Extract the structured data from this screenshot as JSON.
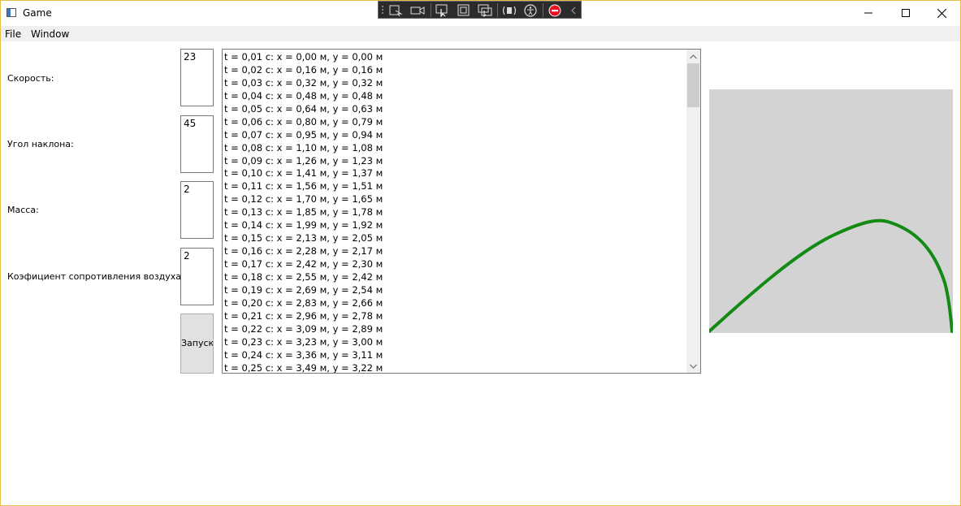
{
  "window": {
    "title": "Game"
  },
  "menu": {
    "items": [
      "File",
      "Window"
    ]
  },
  "form": {
    "labels": [
      "Скорость:",
      "Угол наклона:",
      "Масса:",
      "Коэфициент сопротивления воздуха:"
    ],
    "values": [
      "23",
      "45",
      "2",
      "2"
    ],
    "run_label": "Запуск"
  },
  "log": {
    "lines": [
      "t = 0,01 с: x = 0,00 м, y = 0,00 м",
      "t = 0,02 с: x = 0,16 м, y = 0,16 м",
      "t = 0,03 с: x = 0,32 м, y = 0,32 м",
      "t = 0,04 с: x = 0,48 м, y = 0,48 м",
      "t = 0,05 с: x = 0,64 м, y = 0,63 м",
      "t = 0,06 с: x = 0,80 м, y = 0,79 м",
      "t = 0,07 с: x = 0,95 м, y = 0,94 м",
      "t = 0,08 с: x = 1,10 м, y = 1,08 м",
      "t = 0,09 с: x = 1,26 м, y = 1,23 м",
      "t = 0,10 с: x = 1,41 м, y = 1,37 м",
      "t = 0,11 с: x = 1,56 м, y = 1,51 м",
      "t = 0,12 с: x = 1,70 м, y = 1,65 м",
      "t = 0,13 с: x = 1,85 м, y = 1,78 м",
      "t = 0,14 с: x = 1,99 м, y = 1,92 м",
      "t = 0,15 с: x = 2,13 м, y = 2,05 м",
      "t = 0,16 с: x = 2,28 м, y = 2,17 м",
      "t = 0,17 с: x = 2,42 м, y = 2,30 м",
      "t = 0,18 с: x = 2,55 м, y = 2,42 м",
      "t = 0,19 с: x = 2,69 м, y = 2,54 м",
      "t = 0,20 с: x = 2,83 м, y = 2,66 м",
      "t = 0,21 с: x = 2,96 м, y = 2,78 м",
      "t = 0,22 с: x = 3,09 м, y = 2,89 м",
      "t = 0,23 с: x = 3,23 м, y = 3,00 м",
      "t = 0,24 с: x = 3,36 м, y = 3,11 м",
      "t = 0,25 с: x = 3,49 м, y = 3,22 м"
    ]
  },
  "trajectory": {
    "color": "#138a13",
    "background": "#d3d3d3"
  },
  "debug_toolbar": {
    "icons": [
      "gripper-icon",
      "select-element-icon",
      "camera-icon",
      "pointer-select-icon",
      "layout-adorner-icon",
      "track-focus-icon",
      "binding-failures-icon",
      "accessibility-icon",
      "stop-icon",
      "collapse-chevron-icon"
    ]
  },
  "colors": {
    "window_border": "#e3c04a",
    "menu_bg": "#f0f0f0",
    "button_bg": "#e1e1e1"
  }
}
